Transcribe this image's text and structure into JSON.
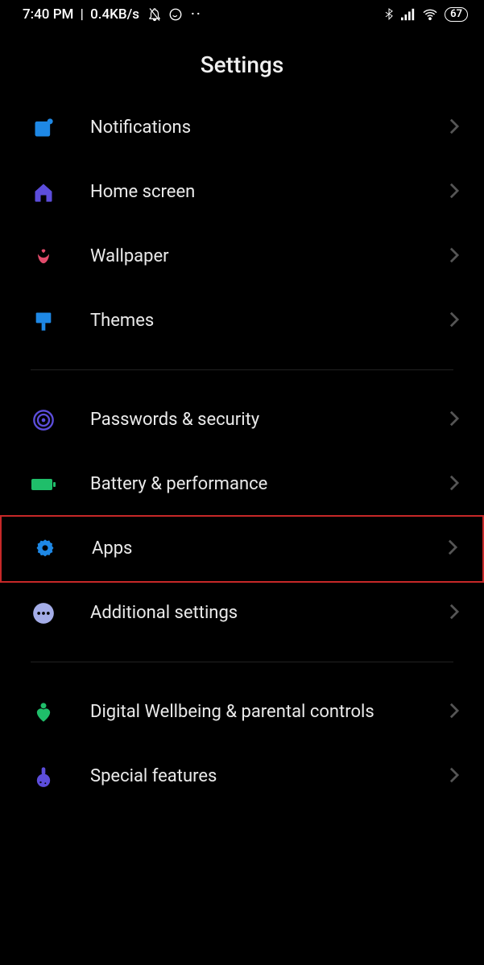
{
  "status": {
    "time": "7:40 PM",
    "data_rate": "0.4KB/s",
    "battery": "67"
  },
  "title": "Settings",
  "sections": [
    {
      "items": [
        {
          "icon": "notifications-icon",
          "color": "#1E88E5",
          "label": "Notifications"
        },
        {
          "icon": "home-icon",
          "color": "#5C4DDB",
          "label": "Home screen"
        },
        {
          "icon": "wallpaper-icon",
          "color": "#E14B6B",
          "label": "Wallpaper"
        },
        {
          "icon": "themes-icon",
          "color": "#1E88E5",
          "label": "Themes"
        }
      ]
    },
    {
      "items": [
        {
          "icon": "fingerprint-icon",
          "color": "#5C4DDB",
          "label": "Passwords & security"
        },
        {
          "icon": "battery-icon",
          "color": "#1FBE6A",
          "label": "Battery & performance"
        },
        {
          "icon": "gear-icon",
          "color": "#1E88E5",
          "label": "Apps",
          "highlighted": true
        },
        {
          "icon": "dots-icon",
          "color": "#A4ADE8",
          "label": "Additional settings"
        }
      ]
    },
    {
      "items": [
        {
          "icon": "heart-icon",
          "color": "#1FBE6A",
          "label": "Digital Wellbeing & parental controls"
        },
        {
          "icon": "flask-icon",
          "color": "#5C4DDB",
          "label": "Special features"
        }
      ]
    }
  ]
}
